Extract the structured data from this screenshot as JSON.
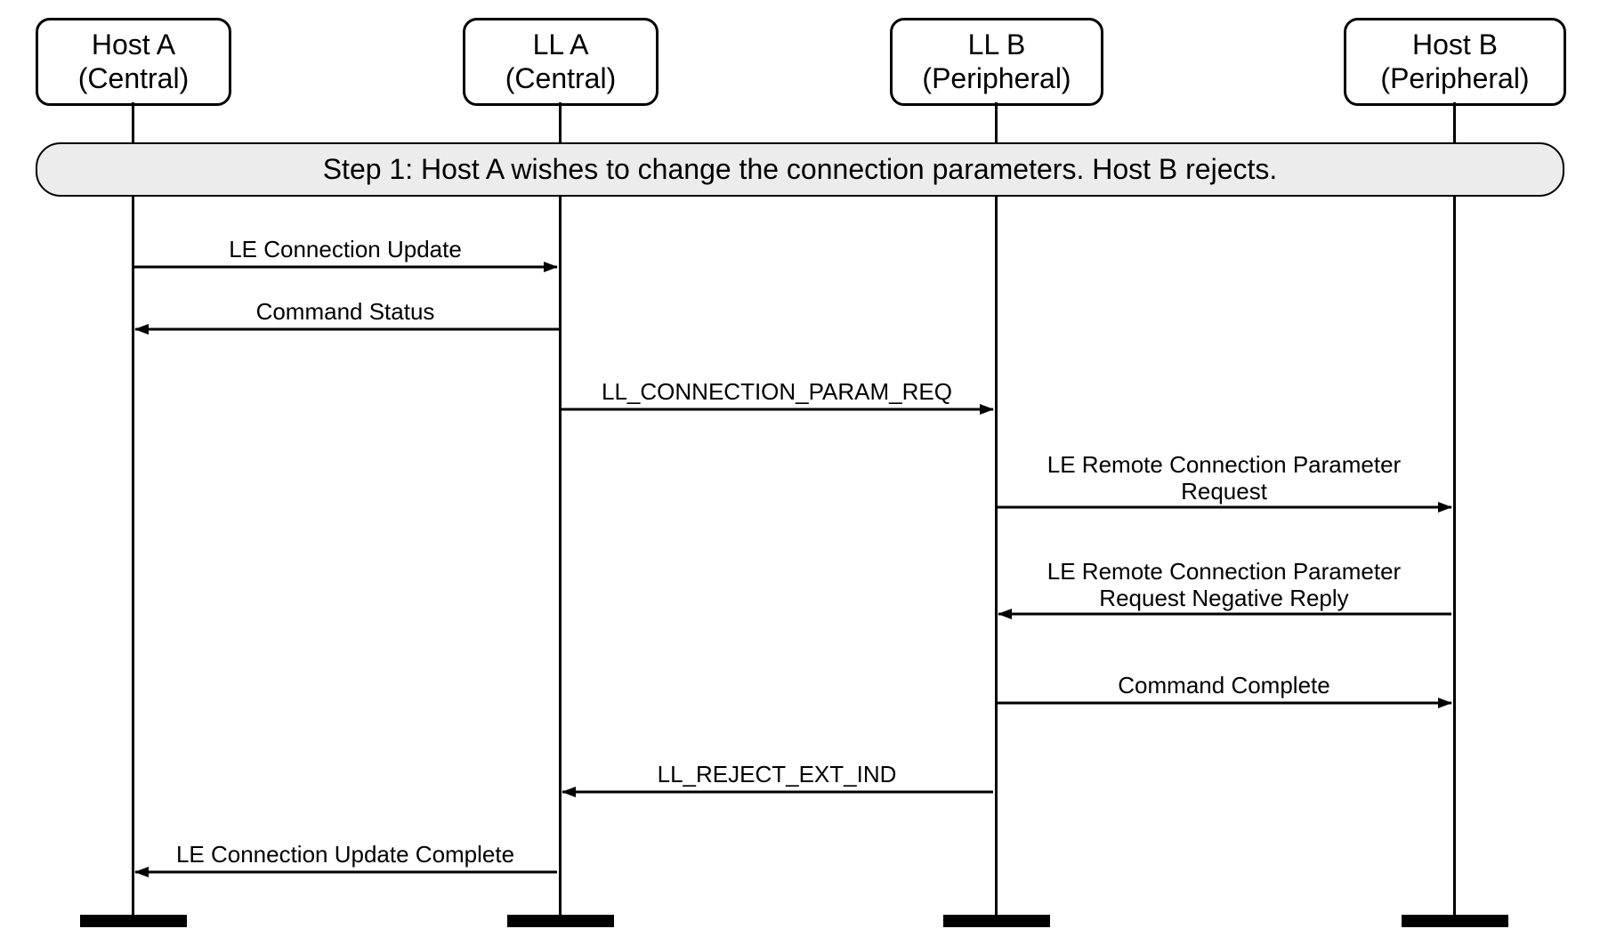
{
  "participants": {
    "hostA": {
      "line1": "Host A",
      "line2": "(Central)"
    },
    "llA": {
      "line1": "LL A",
      "line2": "(Central)"
    },
    "llB": {
      "line1": "LL B",
      "line2": "(Peripheral)"
    },
    "hostB": {
      "line1": "Host B",
      "line2": "(Peripheral)"
    }
  },
  "step_banner": "Step 1:  Host A wishes to change the connection parameters.  Host B rejects.",
  "messages": {
    "m1": "LE Connection Update",
    "m2": "Command Status",
    "m3": "LL_CONNECTION_PARAM_REQ",
    "m4": "LE Remote Connection Parameter\nRequest",
    "m5": "LE Remote Connection Parameter\nRequest Negative Reply",
    "m6": "Command Complete",
    "m7": "LL_REJECT_EXT_IND",
    "m8": "LE Connection Update Complete"
  },
  "chart_data": {
    "type": "sequence-diagram",
    "participants": [
      {
        "id": "hostA",
        "label": "Host A (Central)"
      },
      {
        "id": "llA",
        "label": "LL A (Central)"
      },
      {
        "id": "llB",
        "label": "LL B (Peripheral)"
      },
      {
        "id": "hostB",
        "label": "Host B (Peripheral)"
      }
    ],
    "steps": [
      {
        "label": "Step 1: Host A wishes to change the connection parameters. Host B rejects."
      }
    ],
    "messages": [
      {
        "from": "hostA",
        "to": "llA",
        "label": "LE Connection Update"
      },
      {
        "from": "llA",
        "to": "hostA",
        "label": "Command Status"
      },
      {
        "from": "llA",
        "to": "llB",
        "label": "LL_CONNECTION_PARAM_REQ"
      },
      {
        "from": "llB",
        "to": "hostB",
        "label": "LE Remote Connection Parameter Request"
      },
      {
        "from": "hostB",
        "to": "llB",
        "label": "LE Remote Connection Parameter Request Negative Reply"
      },
      {
        "from": "llB",
        "to": "hostB",
        "label": "Command Complete"
      },
      {
        "from": "llB",
        "to": "llA",
        "label": "LL_REJECT_EXT_IND"
      },
      {
        "from": "llA",
        "to": "hostA",
        "label": "LE Connection Update Complete"
      }
    ]
  }
}
